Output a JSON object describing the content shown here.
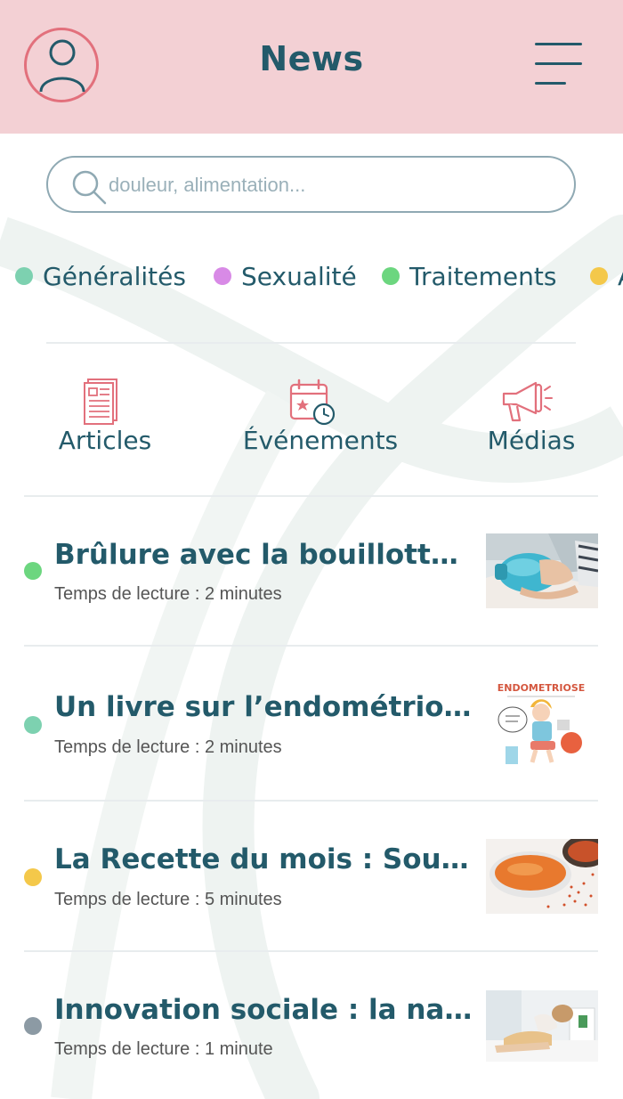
{
  "header": {
    "title": "News"
  },
  "search": {
    "placeholder": "douleur, alimentation..."
  },
  "categories": [
    {
      "label": "Généralités",
      "color": "#7dd1b0"
    },
    {
      "label": "Sexualité",
      "color": "#d88ae6"
    },
    {
      "label": "Traitements",
      "color": "#6cd67f"
    },
    {
      "label": "A",
      "color": "#f4c84a"
    }
  ],
  "content_types": [
    {
      "label": "Articles",
      "icon": "newspaper-icon"
    },
    {
      "label": "Événements",
      "icon": "calendar-clock-icon"
    },
    {
      "label": "Médias",
      "icon": "megaphone-icon"
    }
  ],
  "articles": [
    {
      "title": "Brûlure avec la bouillotte : l…",
      "meta": "Temps de lecture : 2 minutes",
      "dot_color": "#6cd67f",
      "thumb": "hot-water-bottle-photo"
    },
    {
      "title": "Un livre sur l’endométriose …",
      "meta": "Temps de lecture : 2 minutes",
      "dot_color": "#7dd1b0",
      "thumb": "endometriose-book-cover",
      "thumb_text": "ENDOMETRIOSE"
    },
    {
      "title": "La Recette du mois : Soupe …",
      "meta": "Temps de lecture : 5 minutes",
      "dot_color": "#f4c84a",
      "thumb": "lentil-soup-photo"
    },
    {
      "title": "Innovation sociale : la naiss…",
      "meta": "Temps de lecture : 1 minute",
      "dot_color": "#8c9aa4",
      "thumb": "woman-in-pain-photo"
    }
  ],
  "colors": {
    "header_bg": "#f3d0d4",
    "accent_pink": "#e2707c",
    "text_dark": "#235a6a"
  }
}
